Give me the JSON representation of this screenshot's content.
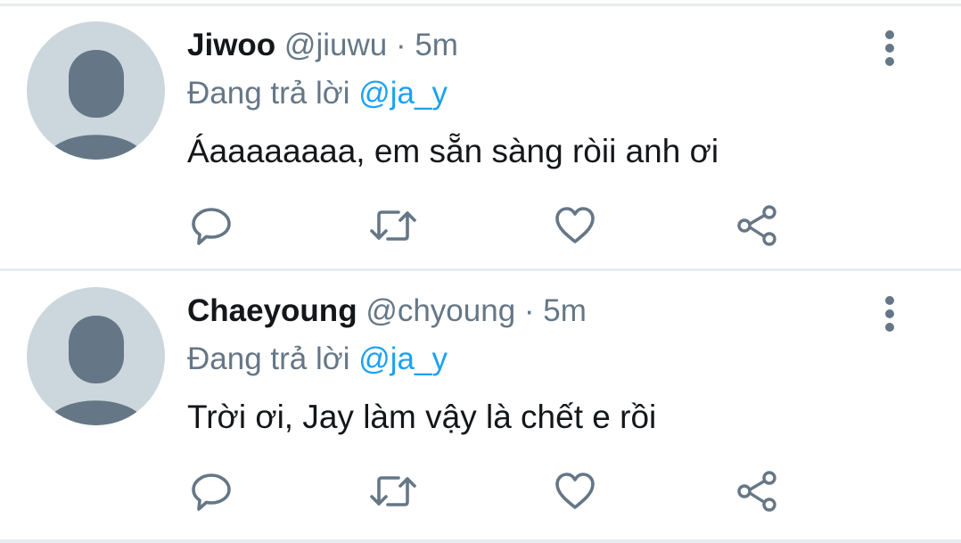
{
  "tweets": [
    {
      "name": "Jiwoo",
      "handle": "@jiuwu",
      "separator": "·",
      "time": "5m",
      "reply_prefix": "Đang trả lời",
      "reply_to": "@ja_y",
      "text": "Áaaaaaaaa, em sẵn sàng ròii anh ơi",
      "icons": [
        "more-vertical-icon",
        "reply-icon",
        "retweet-icon",
        "heart-icon",
        "share-icon"
      ]
    },
    {
      "name": "Chaeyoung",
      "handle": "@chyoung",
      "separator": "·",
      "time": "5m",
      "reply_prefix": "Đang trả lời",
      "reply_to": "@ja_y",
      "text": "Trời ơi, Jay làm vậy là chết e rồi",
      "icons": [
        "more-vertical-icon",
        "reply-icon",
        "retweet-icon",
        "heart-icon",
        "share-icon"
      ]
    }
  ],
  "colors": {
    "text": "#14171a",
    "secondary": "#657786",
    "mention": "#1da1f2",
    "avatar_bg": "#ccd6dd",
    "avatar_fg": "#657786",
    "divider": "#e6ecf0"
  }
}
